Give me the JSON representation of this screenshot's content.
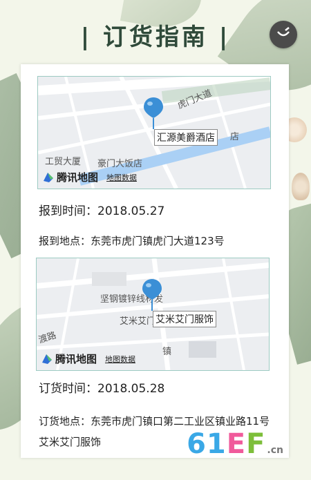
{
  "page": {
    "title": "| 订货指南 |"
  },
  "controls": {
    "music_icon": "music-note-icon"
  },
  "maps": [
    {
      "pin_label": "汇源美爵酒店",
      "streets": [
        "虎门大道",
        "工贸大厦",
        "豪门大饭店",
        "店"
      ],
      "brand": "腾讯地图",
      "data_link": "地图数据"
    },
    {
      "pin_label": "艾米艾门服饰",
      "streets": [
        "坚钢镀锌线材发",
        "艾米艾门服饰",
        "渡路",
        "镇"
      ],
      "brand": "腾讯地图",
      "data_link": "地图数据"
    }
  ],
  "events": [
    {
      "date_label": "报到时间：2018.05.27",
      "address_label": "报到地点：东莞市虎门镇虎门大道123号"
    },
    {
      "date_label": "订货时间：2018.05.28",
      "address_label": "订货地点：东莞市虎门镇口第二工业区镇业路11号艾米艾门服饰"
    }
  ],
  "watermark": {
    "text": "61EF",
    "suffix": ".cn",
    "colors": [
      "#3aa8e6",
      "#3aa8e6",
      "#f05a9b",
      "#7dbe3a"
    ]
  }
}
